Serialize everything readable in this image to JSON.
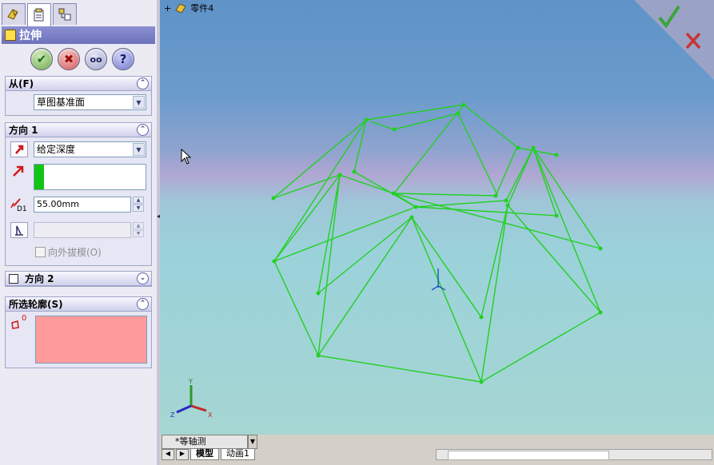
{
  "panel": {
    "tabs": [
      {
        "icon": "feature-tree-icon"
      },
      {
        "icon": "property-manager-icon"
      },
      {
        "icon": "config-manager-icon"
      }
    ],
    "title": "拉伸",
    "actions": {
      "ok": "✔",
      "cancel": "✖",
      "preview": "oo",
      "help": "?"
    }
  },
  "from_group": {
    "title": "从(F)",
    "select_value": "草图基准面"
  },
  "direction1": {
    "title": "方向 1",
    "end_condition": "给定深度",
    "depth_value": "55.00mm",
    "depth_label": "D1",
    "draft_outward_label": "向外拔模(O)"
  },
  "direction2": {
    "title": "方向 2",
    "checked": false
  },
  "selected_contours": {
    "title": "所选轮廓(S)",
    "icon_label": "0",
    "list_color": "#ff9b9b"
  },
  "viewport": {
    "tree_label": "零件4",
    "triad_labels": {
      "x": "X",
      "y": "Y",
      "z": "Z"
    }
  },
  "bottom": {
    "view_name": "*等轴测",
    "tabs": [
      "模型",
      "动画1"
    ]
  },
  "colors": {
    "wireframe": "#22d022",
    "accept_green": "#3aa53a",
    "reject_red": "#c83232"
  }
}
